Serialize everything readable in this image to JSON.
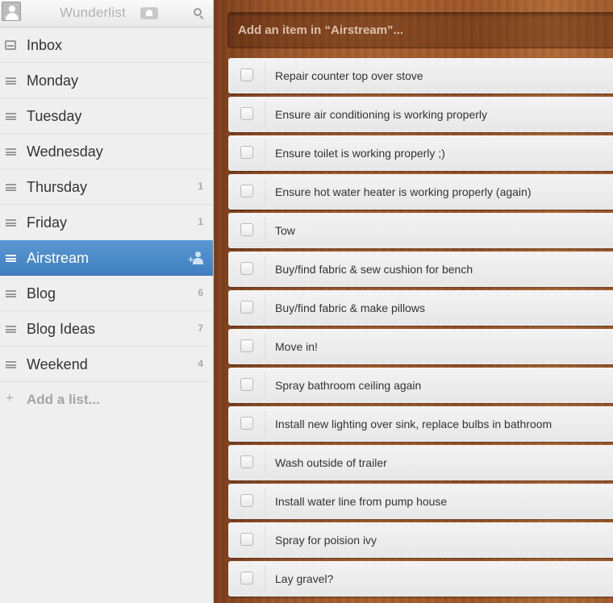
{
  "app": {
    "title": "Wunderlist"
  },
  "sidebar": {
    "lists": [
      {
        "label": "Inbox",
        "count": "",
        "icon": "inbox-icon",
        "active": false
      },
      {
        "label": "Monday",
        "count": "",
        "icon": "list-icon",
        "active": false
      },
      {
        "label": "Tuesday",
        "count": "",
        "icon": "list-icon",
        "active": false
      },
      {
        "label": "Wednesday",
        "count": "",
        "icon": "list-icon",
        "active": false
      },
      {
        "label": "Thursday",
        "count": "1",
        "icon": "list-icon",
        "active": false
      },
      {
        "label": "Friday",
        "count": "1",
        "icon": "list-icon",
        "active": false
      },
      {
        "label": "Airstream",
        "count": "",
        "icon": "list-icon",
        "active": true
      },
      {
        "label": "Blog",
        "count": "6",
        "icon": "list-icon",
        "active": false
      },
      {
        "label": "Blog Ideas",
        "count": "7",
        "icon": "list-icon",
        "active": false
      },
      {
        "label": "Weekend",
        "count": "4",
        "icon": "list-icon",
        "active": false
      }
    ],
    "add_list_label": "Add a list..."
  },
  "main": {
    "add_item_placeholder": "Add an item in “Airstream”...",
    "tasks": [
      {
        "text": "Repair counter top over stove"
      },
      {
        "text": "Ensure air conditioning is working properly"
      },
      {
        "text": "Ensure toilet is working properly ;)"
      },
      {
        "text": "Ensure hot water heater is working properly (again)"
      },
      {
        "text": "Tow"
      },
      {
        "text": "Buy/find fabric & sew cushion for bench"
      },
      {
        "text": "Buy/find fabric & make pillows"
      },
      {
        "text": "Move in!"
      },
      {
        "text": "Spray bathroom ceiling again"
      },
      {
        "text": "Install new lighting over sink, replace bulbs in bathroom"
      },
      {
        "text": "Wash outside of trailer"
      },
      {
        "text": "Install water line from pump house"
      },
      {
        "text": "Spray for poision ivy"
      },
      {
        "text": "Lay gravel?"
      }
    ]
  },
  "colors": {
    "active_list": "#4a8cc9",
    "wood": "#a05a2c"
  }
}
